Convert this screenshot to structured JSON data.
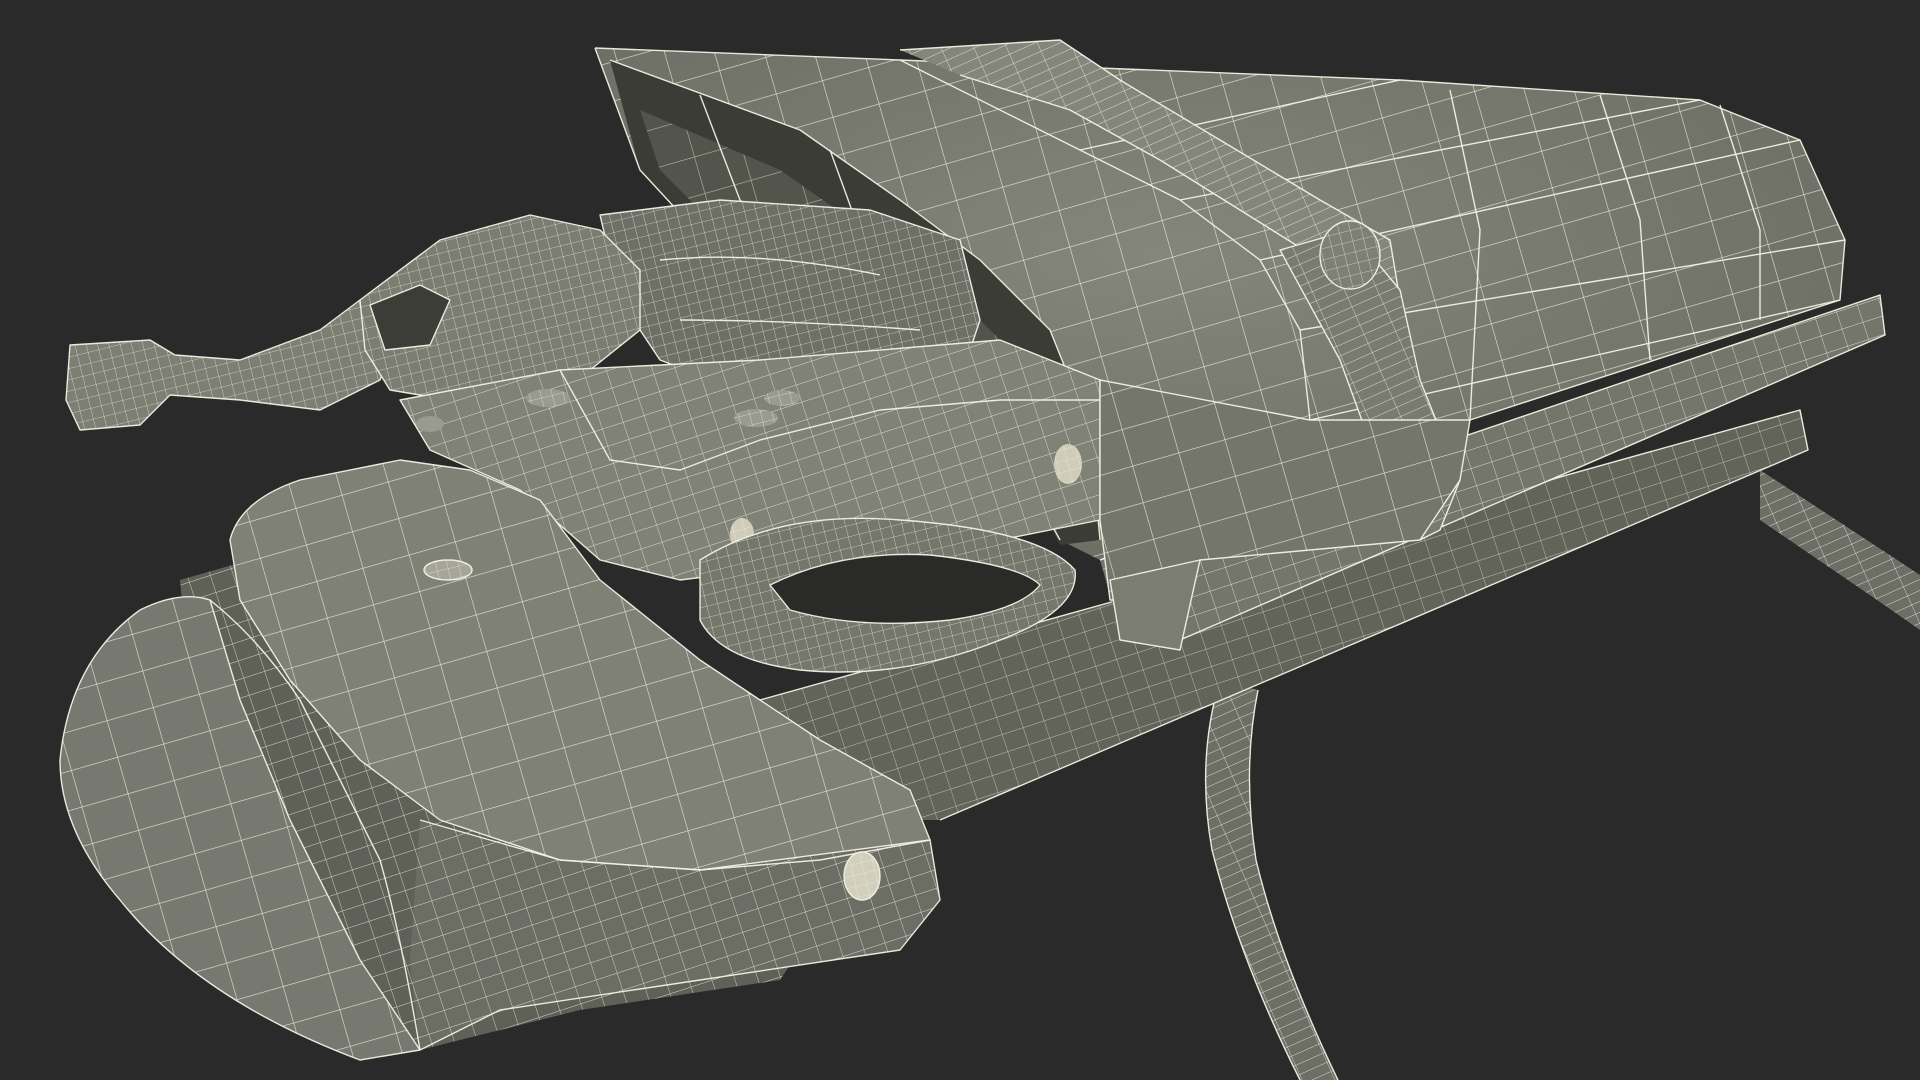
{
  "scene": {
    "subject": "revolver-in-holster-wireframe",
    "render_mode": "wireframe-on-shaded",
    "colors": {
      "background": "#2a2a2a",
      "surface": "#7a7b70",
      "surface_light": "#8a8b80",
      "surface_dark": "#5e5f56",
      "shadow": "#1e1e1c",
      "wire": "#f2f1e4"
    }
  }
}
